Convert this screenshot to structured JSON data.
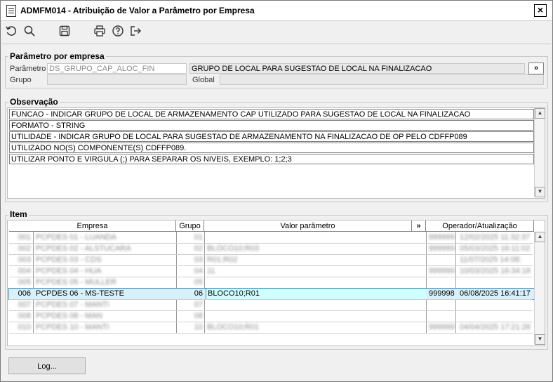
{
  "window": {
    "title": "ADMFM014 - Atribuição de Valor a Parâmetro por Empresa",
    "close_label": "×"
  },
  "toolbar": {
    "icons": [
      "undo-icon",
      "search-icon",
      "save-icon",
      "print-icon",
      "help-icon",
      "exit-icon"
    ]
  },
  "parametro_section": {
    "legend": "Parâmetro por empresa",
    "parametro_label": "Parâmetro",
    "parametro_value": "DS_GRUPO_CAP_ALOC_FIN",
    "descricao_value": "GRUPO DE LOCAL PARA SUGESTAO DE LOCAL NA FINALIZACAO",
    "expand_label": "»",
    "grupo_label": "Grupo",
    "grupo_value": "",
    "global_label": "Global",
    "global_value": ""
  },
  "observacao": {
    "legend": "Observação",
    "lines": [
      "FUNCAO - INDICAR GRUPO DE LOCAL DE ARMAZENAMENTO CAP UTILIZADO PARA SUGESTAO DE LOCAL NA FINALIZACAO",
      "FORMATO - STRING",
      "UTILIDADE - INDICAR GRUPO DE LOCAL PARA SUGESTAO DE ARMAZENAMENTO NA FINALIZACAO DE OP PELO CDFFP089",
      "UTILIZADO NO(S) COMPONENTE(S) CDFFP089.",
      "UTILIZAR PONTO E VIRGULA (;) PARA SEPARAR OS NIVEIS, EXEMPLO: 1;2;3"
    ]
  },
  "item": {
    "legend": "Item",
    "headers": {
      "empresa": "Empresa",
      "grupo": "Grupo",
      "valor": "Valor parâmetro",
      "expand": "»",
      "operador": "Operador/Atualização"
    },
    "rows": [
      {
        "code": "001",
        "empresa": "PCPDES 01 - LUANDA",
        "grupo": "01",
        "valor": "",
        "operador": "999999",
        "data": "12/02/2025 11:32:37",
        "blurred": true,
        "selected": false
      },
      {
        "code": "002",
        "empresa": "PCPDES 02 - ALSTUCARA",
        "grupo": "02",
        "valor": "BLOCO10;R03",
        "operador": "999999",
        "data": "05/03/2025 16:11:02",
        "blurred": true,
        "selected": false
      },
      {
        "code": "003",
        "empresa": "PCPDES 03 - CDS",
        "grupo": "03",
        "valor": "R01;R02",
        "operador": "",
        "data": "11/07/2025 14:08:",
        "blurred": true,
        "selected": false
      },
      {
        "code": "004",
        "empresa": "PCPDES 04 - HUA",
        "grupo": "04",
        "valor": "11",
        "operador": "999999",
        "data": "10/03/2025 16:34:18",
        "blurred": true,
        "selected": false
      },
      {
        "code": "005",
        "empresa": "PCPDES 05 - MULLER",
        "grupo": "05",
        "valor": "",
        "operador": "",
        "data": "",
        "blurred": true,
        "selected": false
      },
      {
        "code": "006",
        "empresa": "PCPDES 06 - MS-TESTE",
        "grupo": "06",
        "valor": "BLOCO10;R01",
        "operador": "999998",
        "data": "06/08/2025 16:41:17",
        "blurred": false,
        "selected": true
      },
      {
        "code": "007",
        "empresa": "PCPDES 07 - MANTI",
        "grupo": "07",
        "valor": "",
        "operador": "",
        "data": "",
        "blurred": true,
        "selected": false
      },
      {
        "code": "008",
        "empresa": "PCPDES 08 - MAN",
        "grupo": "08",
        "valor": "",
        "operador": "",
        "data": "",
        "blurred": true,
        "selected": false
      },
      {
        "code": "010",
        "empresa": "PCPDES 10 - MANTI",
        "grupo": "10",
        "valor": "BLOCO10;R01",
        "operador": "999999",
        "data": "04/04/2025 17:21:26",
        "blurred": true,
        "selected": false
      }
    ]
  },
  "footer": {
    "log_button": "Log..."
  }
}
